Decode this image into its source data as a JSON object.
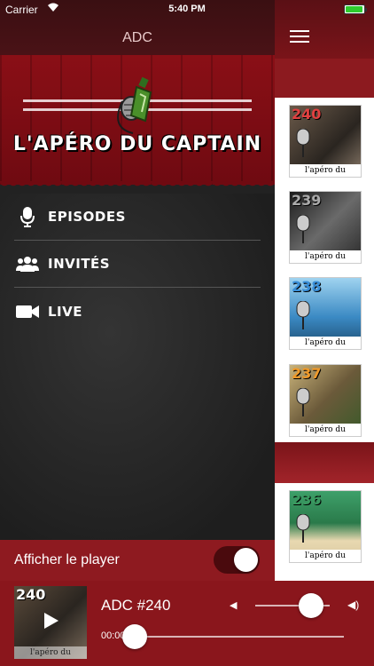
{
  "status_bar": {
    "carrier": "Carrier",
    "time": "5:40 PM",
    "battery_level": 0.9
  },
  "drawer": {
    "title": "ADC",
    "logo_text": "L'APÉRO DU CAPTAIN",
    "menu": [
      {
        "label": "EPISODES",
        "icon": "microphone-icon"
      },
      {
        "label": "INVITÉS",
        "icon": "group-icon"
      },
      {
        "label": "LIVE",
        "icon": "video-camera-icon"
      }
    ]
  },
  "episodes_list": [
    {
      "number": "240",
      "caption": "l'apéro du captain",
      "color": "#c43a3a"
    },
    {
      "number": "239",
      "caption": "l'apéro du captain",
      "color": "#555555"
    },
    {
      "number": "238",
      "caption": "l'apéro du captain",
      "color": "#2b7fc0"
    },
    {
      "number": "237",
      "caption": "l'apéro du captain",
      "color": "#e08a1a"
    },
    {
      "number": "236",
      "caption": "l'apéro du captain",
      "color": "#2f8a55"
    }
  ],
  "player_toggle": {
    "label": "Afficher le player",
    "on": true
  },
  "player": {
    "artwork_number": "240",
    "artwork_caption": "l'apéro du captain",
    "title": "ADC #240",
    "elapsed": "00:00",
    "progress": 0.0,
    "volume": 0.75
  },
  "colors": {
    "accent": "#8a161c",
    "dark_header": "#3a0f12"
  }
}
